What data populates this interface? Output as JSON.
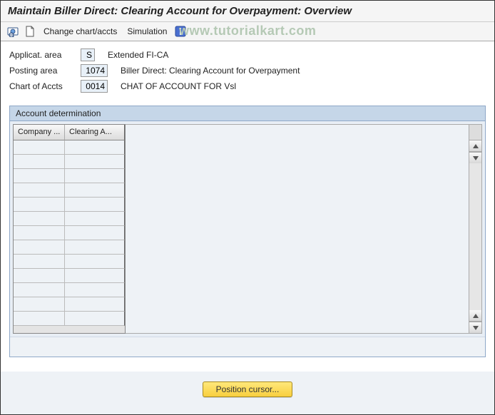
{
  "title": "Maintain Biller Direct: Clearing Account for Overpayment: Overview",
  "toolbar": {
    "change_label": "Change chart/accts",
    "simulation_label": "Simulation"
  },
  "watermark": "www.tutorialkart.com",
  "header": {
    "applicat_label": "Applicat. area",
    "applicat_value": "S",
    "applicat_desc": "Extended FI-CA",
    "posting_label": "Posting area",
    "posting_value": "1074",
    "posting_desc": "Biller Direct: Clearing Account for Overpayment",
    "chart_label": "Chart of Accts",
    "chart_value": "0014",
    "chart_desc": "CHAT OF ACCOUNT FOR Vsl"
  },
  "group": {
    "title": "Account determination",
    "col1": "Company ...",
    "col2": "Clearing A..."
  },
  "button": {
    "position": "Position cursor..."
  }
}
